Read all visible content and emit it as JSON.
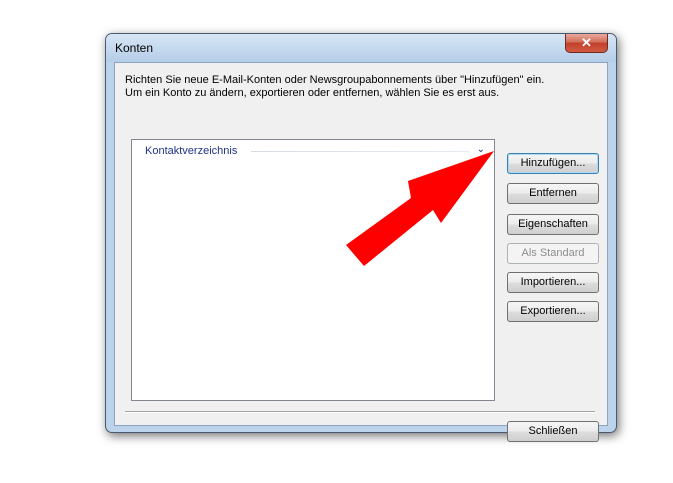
{
  "window": {
    "title": "Konten",
    "close_glyph": "✕"
  },
  "intro": {
    "line1": "Richten Sie neue E-Mail-Konten oder Newsgroupabonnements über \"Hinzufügen\" ein.",
    "line2": "Um ein Konto zu ändern, exportieren oder entfernen, wählen Sie es erst aus."
  },
  "list": {
    "group_label": "Kontaktverzeichnis",
    "chevron": "⌄"
  },
  "buttons": {
    "add": "Hinzufügen...",
    "remove": "Entfernen",
    "properties": "Eigenschaften",
    "set_default": "Als Standard",
    "import": "Importieren...",
    "export": "Exportieren...",
    "close": "Schließen"
  },
  "colors": {
    "annotation_arrow": "#ff0000"
  }
}
